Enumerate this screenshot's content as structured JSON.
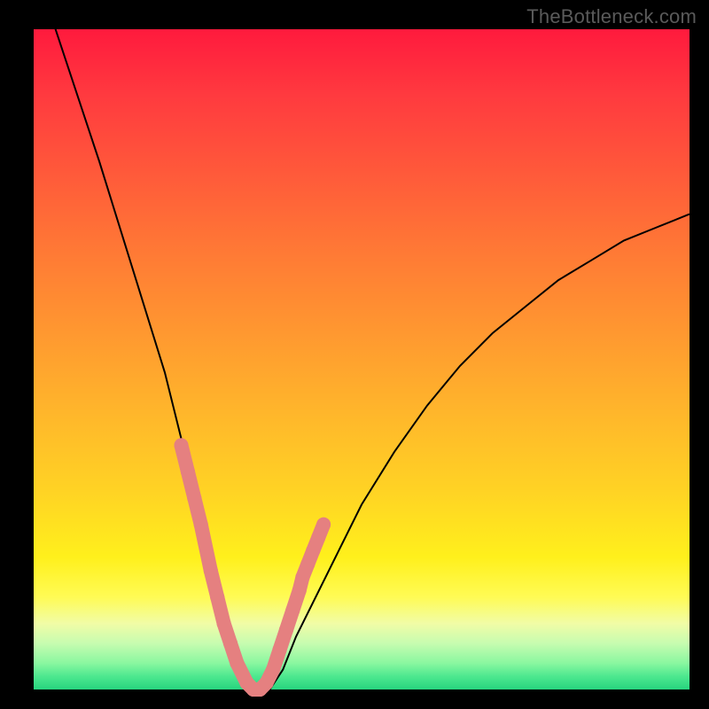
{
  "watermark": "TheBottleneck.com",
  "chart_data": {
    "type": "line",
    "title": "",
    "xlabel": "",
    "ylabel": "",
    "xlim": [
      0,
      100
    ],
    "ylim": [
      0,
      100
    ],
    "series": [
      {
        "name": "bottleneck-curve",
        "x": [
          0,
          5,
          10,
          15,
          20,
          22,
          24,
          26,
          28,
          30,
          32,
          34,
          36,
          38,
          40,
          45,
          50,
          55,
          60,
          65,
          70,
          75,
          80,
          85,
          90,
          95,
          100
        ],
        "values": [
          110,
          95,
          80,
          64,
          48,
          40,
          32,
          24,
          16,
          8,
          3,
          0,
          0,
          3,
          8,
          18,
          28,
          36,
          43,
          49,
          54,
          58,
          62,
          65,
          68,
          70,
          72
        ]
      }
    ],
    "markers": {
      "name": "highlight-dots",
      "x": [
        22.5,
        23.5,
        24.5,
        25.5,
        27.0,
        28.0,
        29.0,
        30.0,
        31.0,
        32.5,
        33.5,
        34.5,
        35.5,
        36.5,
        37.5,
        38.5,
        39.5,
        40.5,
        41.0,
        41.8,
        42.6,
        43.4,
        44.2
      ],
      "values": [
        37,
        33,
        29,
        25,
        18,
        14,
        10,
        7,
        4,
        1,
        0,
        0,
        1,
        3,
        6,
        9,
        12,
        15,
        17,
        19,
        21,
        23,
        25
      ]
    },
    "background_gradient": {
      "top": "#ff1a3d",
      "mid1": "#ff9830",
      "mid2": "#fff01c",
      "bottom": "#27d47e"
    }
  }
}
